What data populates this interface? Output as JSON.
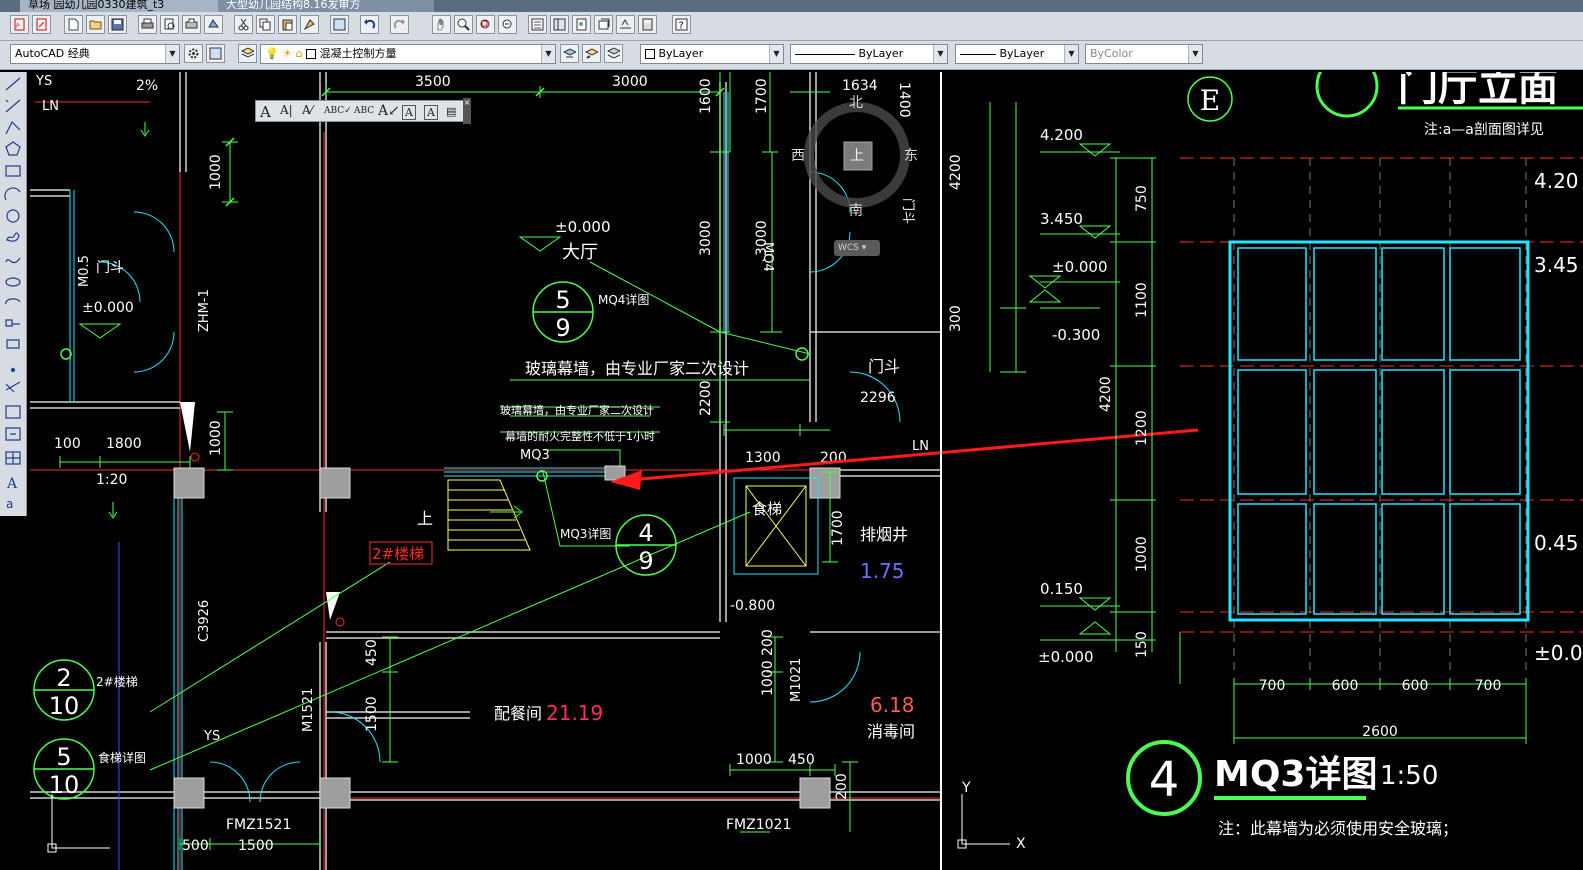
{
  "titlebar": {
    "tabs": [
      "草场   园幼儿园0330建筑_t3",
      "大型幼儿园结构8.16发审方"
    ]
  },
  "workspace": {
    "selected": "AutoCAD 经典"
  },
  "layer": {
    "name": "混凝土控制方量"
  },
  "properties": {
    "color": "ByLayer",
    "linetype": "ByLayer",
    "lineweight": "ByLayer",
    "plotstyle": "ByColor"
  },
  "viewcube": {
    "north": "北",
    "south": "南",
    "east": "东",
    "west": "西",
    "top": "上",
    "wcs": "WCS"
  },
  "plan": {
    "dims": [
      "3500",
      "3000",
      "1634",
      "1400",
      "1600",
      "1700",
      "1000",
      "3000",
      "3000",
      "2200",
      "1300",
      "200",
      "2296",
      "100",
      "1800",
      "1000",
      "1700",
      "450",
      "1500",
      "200",
      "1000",
      "1000",
      "450",
      "200",
      "500",
      "1500"
    ],
    "labels": {
      "ys_top": "YS",
      "ln_top": "LN",
      "slope": "2%",
      "mendou_left": "门斗",
      "mo5": "M0.5",
      "elev_left": "±0.000",
      "zhm": "ZHM-1",
      "elev_hall": "±0.000",
      "hall": "大厅",
      "bubble_mq4_top": "5",
      "bubble_mq4_bottom": "9",
      "mq4_detail": "MQ4详图",
      "mq4_vert": "MQ4",
      "curtain_main": "玻璃幕墙，由专业厂家二次设计",
      "curtain_small1": "玻璃幕墙，由专业厂家二次设计",
      "curtain_small2": "幕墙的耐火完整性不低于1小时",
      "mq3": "MQ3",
      "mq3_detail": "MQ3详图",
      "bubble_mq3_top": "4",
      "bubble_mq3_bottom": "9",
      "mendou_right": "门斗",
      "ln_right": "LN",
      "door_tag": "门斗",
      "scale": "1:20",
      "up": "上",
      "stair2_red": "2#楼梯",
      "food_lift": "食梯",
      "smoke_shaft": "排烟井",
      "elev_175": "1.75",
      "elev_080": "-0.800",
      "c3926": "C3926",
      "bubble_stair_top": "2",
      "bubble_stair_bottom": "10",
      "stair2": "2#楼梯",
      "bubble_lift_top": "5",
      "bubble_lift_bottom": "10",
      "lift_detail": "食梯详图",
      "ys_bottom": "YS",
      "m1521": "M1521",
      "peican": "配餐间",
      "area_peican": "21.19",
      "m1021": "M1021",
      "area_xiaodu": "6.18",
      "xiaodu": "消毒间",
      "fmz1521": "FMZ1521",
      "fmz1021": "FMZ1021"
    }
  },
  "elevation": {
    "axis": "E",
    "title_partial": "门厅立面",
    "note_top": "注:a—a剖面图详见",
    "levels": [
      "4.200",
      "3.450",
      "±0.000",
      "-0.300",
      "0.150",
      "±0.000"
    ],
    "right_levels": [
      "4.20",
      "3.45",
      "0.45",
      "±0.0"
    ],
    "vdims": [
      "750",
      "1100",
      "1200",
      "1000",
      "150",
      "4200",
      "4200",
      "300"
    ],
    "hdims": [
      "700",
      "600",
      "600",
      "700"
    ],
    "total_width": "2600",
    "bubble_num": "4",
    "detail_title": "MQ3详图",
    "detail_scale": "1:50",
    "note_bottom": "注：此幕墙为必须使用安全玻璃；",
    "ucs_y": "Y",
    "ucs_x": "X"
  },
  "colors": {
    "wall": "#ff2a2a",
    "dim": "#4cff4c",
    "text": "#ffffff",
    "cyan": "#22e6ff",
    "yellow": "#ffff55",
    "bg": "#000000"
  }
}
